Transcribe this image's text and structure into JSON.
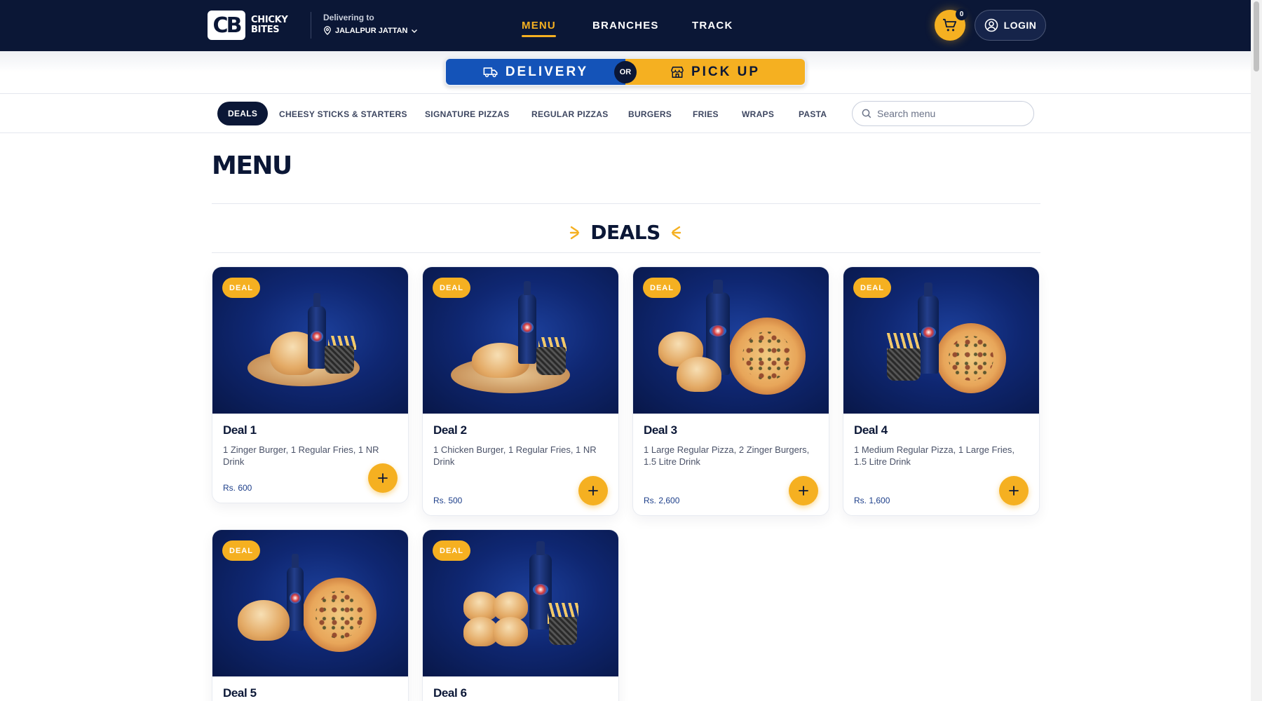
{
  "brand": {
    "mark": "CB",
    "name_line1": "CHICKY",
    "name_line2": "BITES"
  },
  "delivery": {
    "caption": "Delivering to",
    "location": "JALALPUR JATTAN"
  },
  "nav": {
    "menu": "MENU",
    "branches": "BRANCHES",
    "track": "TRACK"
  },
  "cart": {
    "count": "0"
  },
  "login": {
    "label": "LOGIN"
  },
  "mode": {
    "delivery": "DELIVERY",
    "or": "OR",
    "pickup": "PICK UP"
  },
  "categories": [
    "DEALS",
    "CHEESY STICKS & STARTERS",
    "SIGNATURE PIZZAS",
    "REGULAR PIZZAS",
    "BURGERS",
    "FRIES",
    "WRAPS",
    "PASTA"
  ],
  "search": {
    "placeholder": "Search menu"
  },
  "page": {
    "title": "MENU",
    "section": "DEALS"
  },
  "deal_badge": "DEAL",
  "deals": [
    {
      "name": "Deal 1",
      "desc": "1 Zinger Burger, 1 Regular Fries, 1 NR Drink",
      "price": "Rs. 600"
    },
    {
      "name": "Deal 2",
      "desc": "1 Chicken Burger, 1 Regular Fries, 1 NR Drink",
      "price": "Rs. 500"
    },
    {
      "name": "Deal 3",
      "desc": "1 Large Regular Pizza, 2 Zinger Burgers, 1.5 Litre Drink",
      "price": "Rs. 2,600"
    },
    {
      "name": "Deal 4",
      "desc": "1 Medium Regular Pizza, 1 Large Fries, 1.5 Litre Drink",
      "price": "Rs. 1,600"
    },
    {
      "name": "Deal 5"
    },
    {
      "name": "Deal 6"
    }
  ],
  "colors": {
    "navy": "#0b1736",
    "accent": "#f5b021",
    "delivery_blue": "#1453b8"
  },
  "icons": [
    "location-pin-icon",
    "chevron-down-icon",
    "cart-icon",
    "user-icon",
    "truck-icon",
    "store-icon",
    "search-icon",
    "plus-icon",
    "sparkle-icon"
  ]
}
